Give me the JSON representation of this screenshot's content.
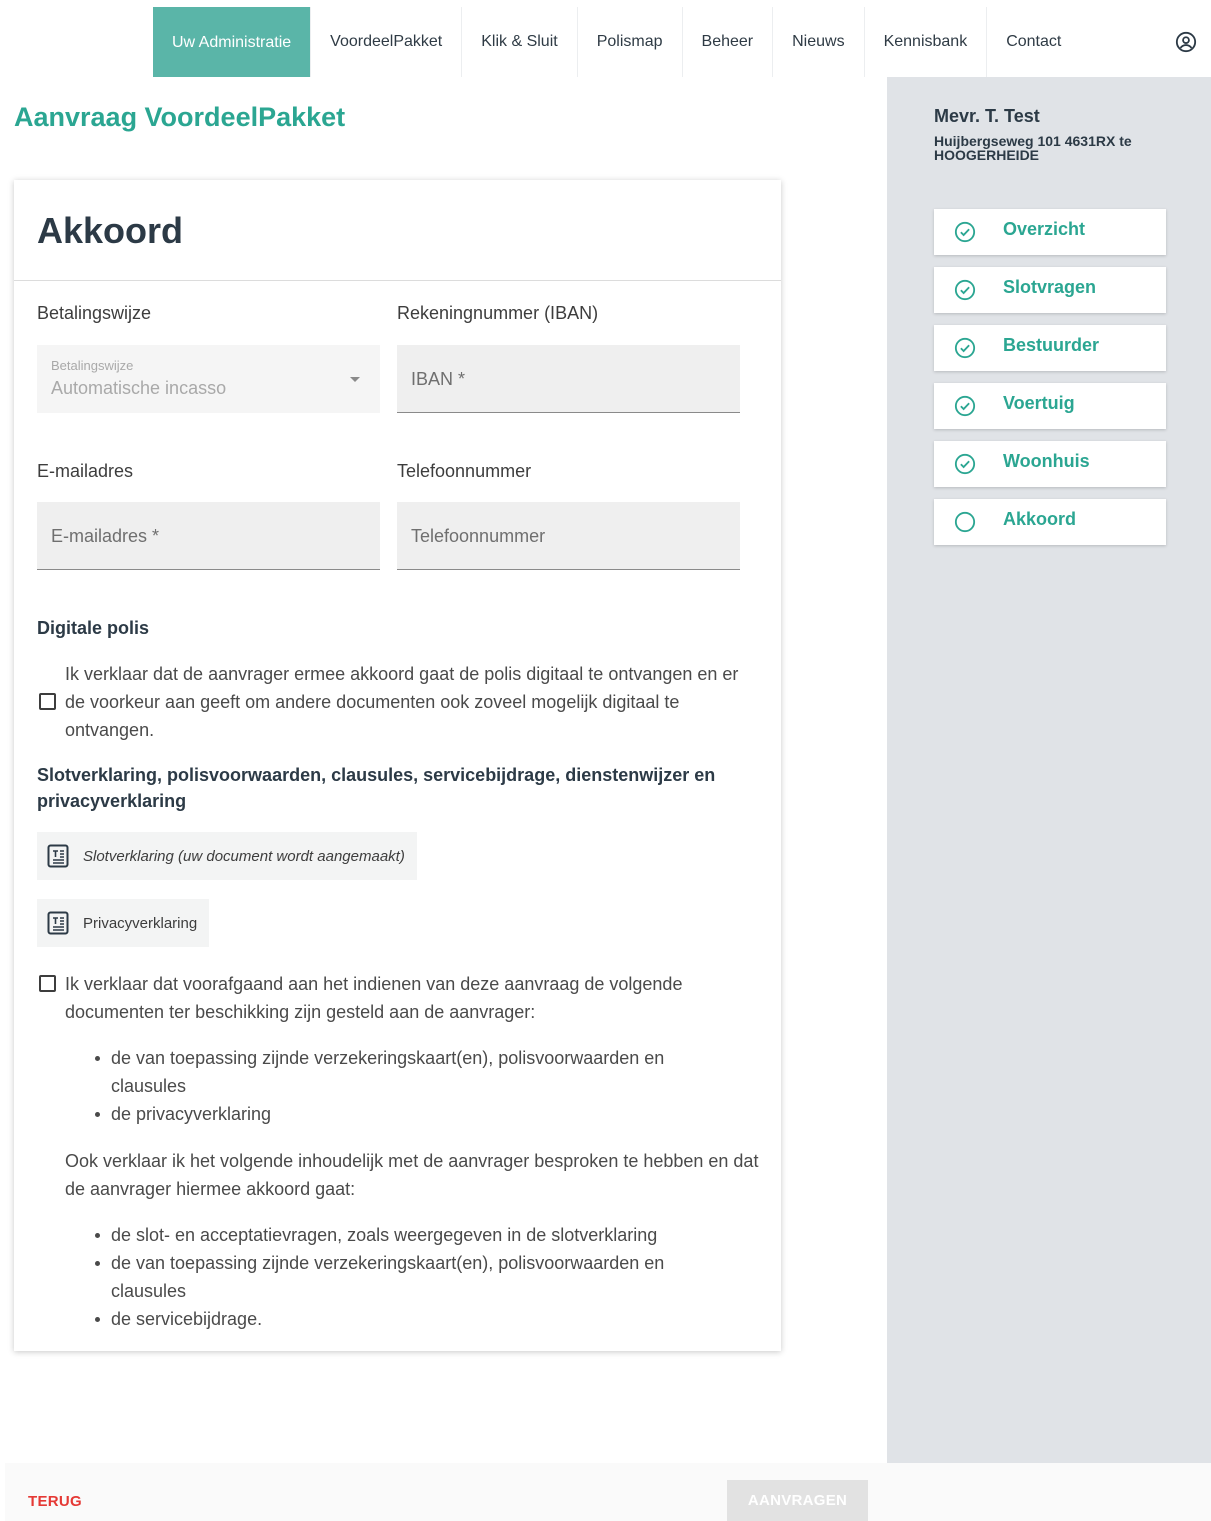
{
  "nav": {
    "items": [
      "Uw Administratie",
      "VoordeelPakket",
      "Klik & Sluit",
      "Polismap",
      "Beheer",
      "Nieuws",
      "Kennisbank",
      "Contact"
    ],
    "active_index": 0,
    "account_icon": "account-circle-icon"
  },
  "page": {
    "title": "Aanvraag VoordeelPakket"
  },
  "card": {
    "title": "Akkoord",
    "payment": {
      "label": "Betalingswijze",
      "small_label": "Betalingswijze",
      "value": "Automatische incasso"
    },
    "iban": {
      "label": "Rekeningnummer (IBAN)",
      "placeholder": "IBAN *"
    },
    "email": {
      "label": "E-mailadres",
      "placeholder": "E-mailadres *"
    },
    "phone": {
      "label": "Telefoonnummer",
      "placeholder": "Telefoonnummer"
    },
    "digital": {
      "heading": "Digitale polis",
      "text": "Ik verklaar dat de aanvrager ermee akkoord gaat de polis digitaal te ontvangen en er de voorkeur aan geeft om andere documenten ook zoveel mogelijk digitaal te ontvangen."
    },
    "declaration": {
      "heading": "Slotverklaring, polisvoorwaarden, clausules, servicebijdrage, dienstenwijzer en privacyverklaring",
      "doc1": "Slotverklaring (uw document wordt aangemaakt)",
      "doc2": "Privacyverklaring",
      "check_text": "Ik verklaar dat voorafgaand aan het indienen van deze aanvraag de volgende documenten ter beschikking zijn gesteld aan de aanvrager:",
      "list1": [
        "de van toepassing zijnde verzekeringskaart(en), polisvoorwaarden en clausules",
        "de privacyverklaring"
      ],
      "text2": "Ook verklaar ik het volgende inhoudelijk met de aanvrager besproken te hebben en dat de aanvrager hiermee akkoord gaat:",
      "list2": [
        "de slot- en acceptatievragen, zoals weergegeven in de slotverklaring",
        "de van toepassing zijnde verzekeringskaart(en), polisvoorwaarden en clausules",
        "de servicebijdrage."
      ]
    }
  },
  "sidebar": {
    "name": "Mevr. T. Test",
    "address": "Huijbergseweg 101 4631RX te HOOGERHEIDE",
    "steps": [
      {
        "label": "Overzicht",
        "done": true
      },
      {
        "label": "Slotvragen",
        "done": true
      },
      {
        "label": "Bestuurder",
        "done": true
      },
      {
        "label": "Voertuig",
        "done": true
      },
      {
        "label": "Woonhuis",
        "done": true
      },
      {
        "label": "Akkoord",
        "done": false
      }
    ]
  },
  "footer": {
    "back": "TERUG",
    "submit": "AANVRAGEN"
  },
  "colors": {
    "brand": "#2ba692",
    "nav_active": "#5ab5a8",
    "danger": "#e53935",
    "sidebar_bg": "#e0e3e7"
  }
}
